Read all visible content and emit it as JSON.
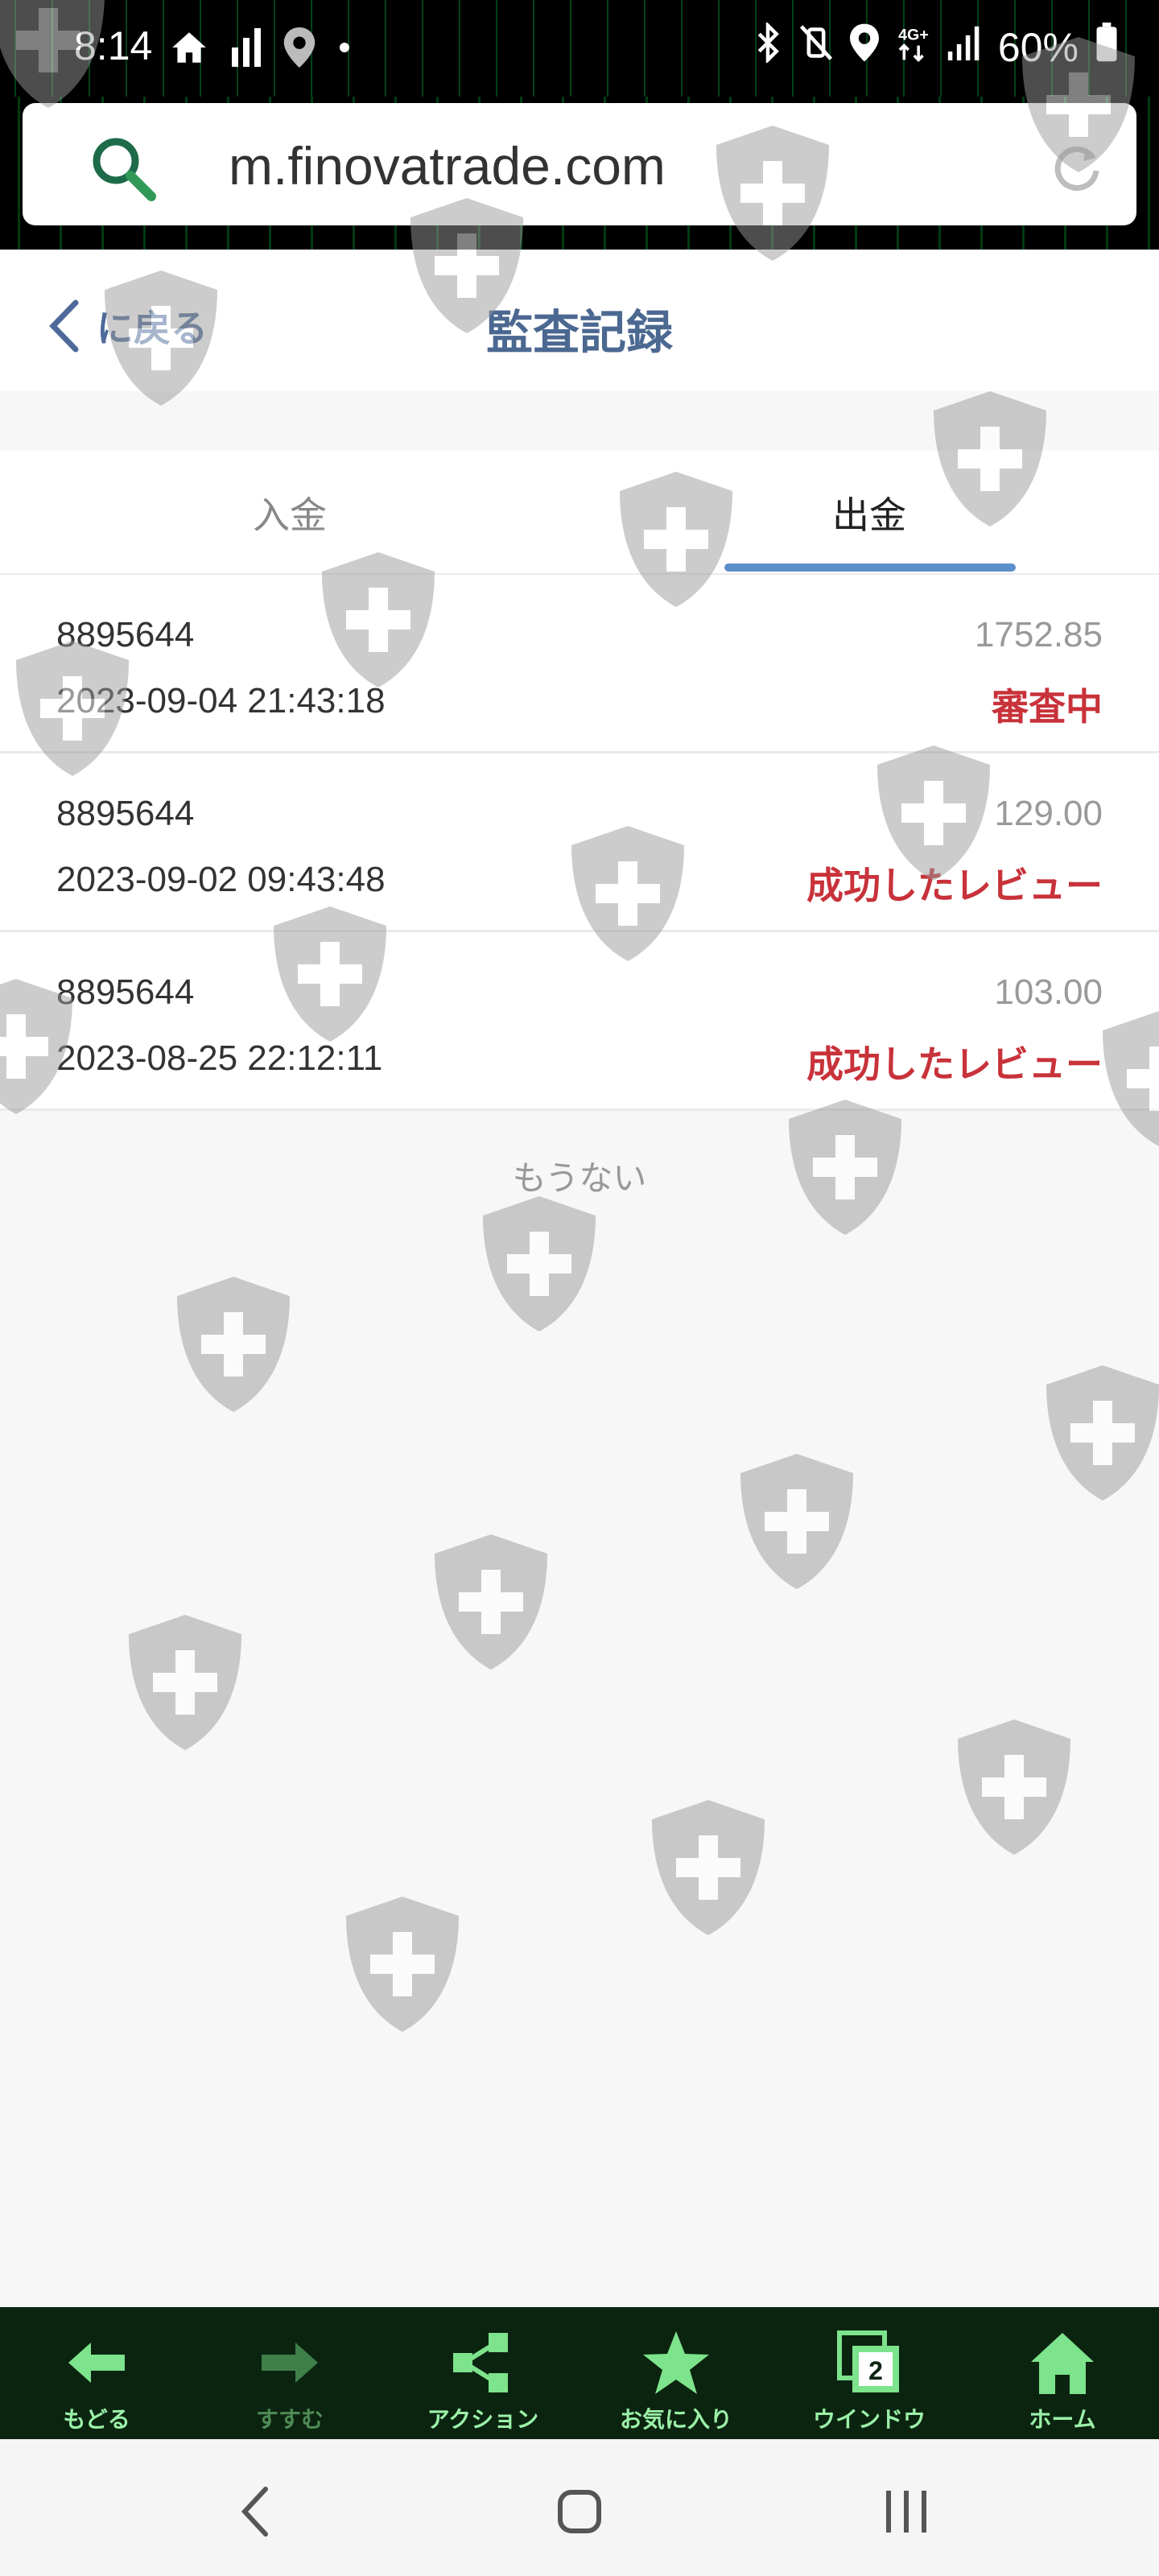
{
  "status_bar": {
    "time": "8:14",
    "battery": "60%",
    "left_icons": [
      "home-icon",
      "signal-bars-icon",
      "location-icon",
      "dot-icon"
    ],
    "right_icons": [
      "bluetooth-icon",
      "vibrate-off-icon",
      "location-icon",
      "4g-icon",
      "signal-icon",
      "battery-icon"
    ]
  },
  "browser": {
    "url": "m.finovatrade.com"
  },
  "header": {
    "back_label": "に戻る",
    "title": "監査記録"
  },
  "tabs": [
    {
      "label": "入金",
      "active": false
    },
    {
      "label": "出金",
      "active": true
    }
  ],
  "records": [
    {
      "id": "8895644",
      "datetime": "2023-09-04 21:43:18",
      "amount": "1752.85",
      "status": "審査中"
    },
    {
      "id": "8895644",
      "datetime": "2023-09-02 09:43:48",
      "amount": "129.00",
      "status": "成功したレビュー"
    },
    {
      "id": "8895644",
      "datetime": "2023-08-25 22:12:11",
      "amount": "103.00",
      "status": "成功したレビュー"
    }
  ],
  "no_more_text": "もうない",
  "toolbar": {
    "back": "もどる",
    "forward": "すすむ",
    "action": "アクション",
    "favorites": "お気に入り",
    "window": "ウインドウ",
    "window_count": "2",
    "home": "ホーム"
  },
  "colors": {
    "title": "#4b6891",
    "status_red": "#c8323a",
    "tab_indicator": "#5b8fc9",
    "toolbar_bg": "#0b2410",
    "toolbar_icon": "#7de38c"
  }
}
